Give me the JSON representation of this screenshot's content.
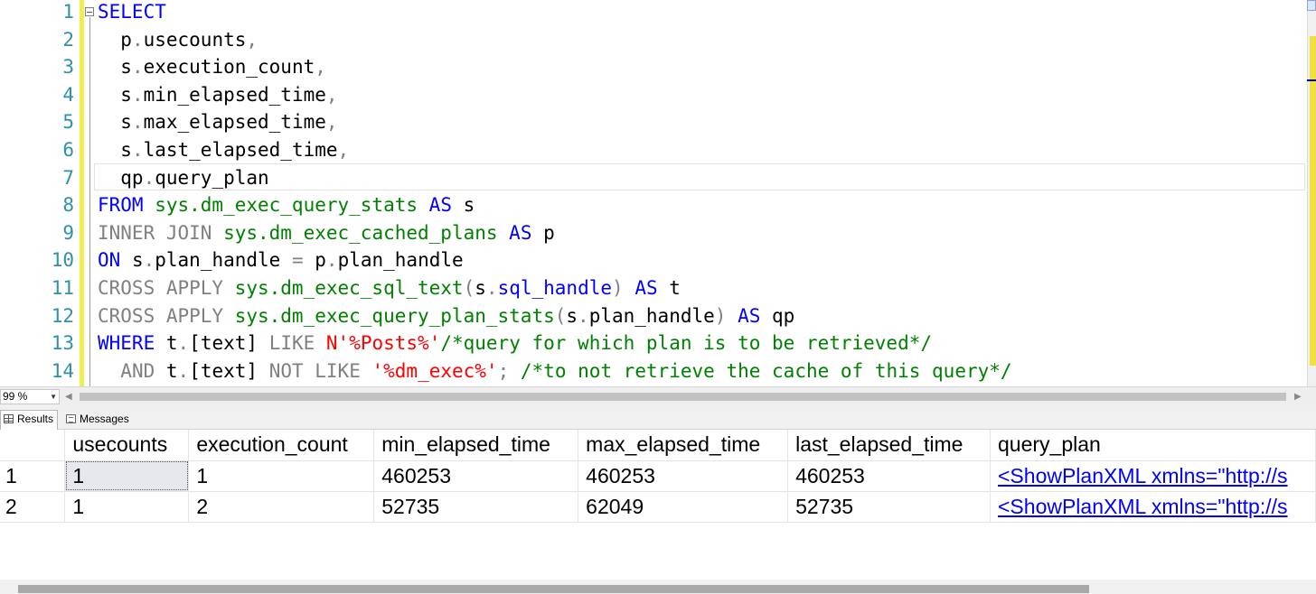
{
  "editor": {
    "line_numbers": [
      "1",
      "2",
      "3",
      "4",
      "5",
      "6",
      "7",
      "8",
      "9",
      "10",
      "11",
      "12",
      "13",
      "14"
    ],
    "lines": [
      [
        {
          "c": "kw",
          "t": "SELECT"
        }
      ],
      [
        {
          "c": "tx",
          "t": "  p"
        },
        {
          "c": "pu",
          "t": "."
        },
        {
          "c": "tx",
          "t": "usecounts"
        },
        {
          "c": "pu",
          "t": ","
        }
      ],
      [
        {
          "c": "tx",
          "t": "  s"
        },
        {
          "c": "pu",
          "t": "."
        },
        {
          "c": "tx",
          "t": "execution_count"
        },
        {
          "c": "pu",
          "t": ","
        }
      ],
      [
        {
          "c": "tx",
          "t": "  s"
        },
        {
          "c": "pu",
          "t": "."
        },
        {
          "c": "tx",
          "t": "min_elapsed_time"
        },
        {
          "c": "pu",
          "t": ","
        }
      ],
      [
        {
          "c": "tx",
          "t": "  s"
        },
        {
          "c": "pu",
          "t": "."
        },
        {
          "c": "tx",
          "t": "max_elapsed_time"
        },
        {
          "c": "pu",
          "t": ","
        }
      ],
      [
        {
          "c": "tx",
          "t": "  s"
        },
        {
          "c": "pu",
          "t": "."
        },
        {
          "c": "tx",
          "t": "last_elapsed_time"
        },
        {
          "c": "pu",
          "t": ","
        }
      ],
      [
        {
          "c": "tx",
          "t": "  qp"
        },
        {
          "c": "pu",
          "t": "."
        },
        {
          "c": "tx",
          "t": "query_plan"
        }
      ],
      [
        {
          "c": "kw",
          "t": "FROM "
        },
        {
          "c": "fn",
          "t": "sys.dm_exec_query_stats"
        },
        {
          "c": "tx",
          "t": " "
        },
        {
          "c": "kw",
          "t": "AS"
        },
        {
          "c": "tx",
          "t": " s"
        }
      ],
      [
        {
          "c": "gk",
          "t": "INNER JOIN "
        },
        {
          "c": "fn",
          "t": "sys.dm_exec_cached_plans"
        },
        {
          "c": "tx",
          "t": " "
        },
        {
          "c": "kw",
          "t": "AS"
        },
        {
          "c": "tx",
          "t": " p"
        }
      ],
      [
        {
          "c": "kw",
          "t": "ON"
        },
        {
          "c": "tx",
          "t": " s"
        },
        {
          "c": "pu",
          "t": "."
        },
        {
          "c": "tx",
          "t": "plan_handle "
        },
        {
          "c": "pu",
          "t": "="
        },
        {
          "c": "tx",
          "t": " p"
        },
        {
          "c": "pu",
          "t": "."
        },
        {
          "c": "tx",
          "t": "plan_handle"
        }
      ],
      [
        {
          "c": "gk",
          "t": "CROSS APPLY "
        },
        {
          "c": "fn",
          "t": "sys.dm_exec_sql_text"
        },
        {
          "c": "pu",
          "t": "("
        },
        {
          "c": "tx",
          "t": "s"
        },
        {
          "c": "pu",
          "t": "."
        },
        {
          "c": "kw",
          "t": "sql_handle"
        },
        {
          "c": "pu",
          "t": ")"
        },
        {
          "c": "tx",
          "t": " "
        },
        {
          "c": "kw",
          "t": "AS"
        },
        {
          "c": "tx",
          "t": " t"
        }
      ],
      [
        {
          "c": "gk",
          "t": "CROSS APPLY "
        },
        {
          "c": "fn",
          "t": "sys.dm_exec_query_plan_stats"
        },
        {
          "c": "pu",
          "t": "("
        },
        {
          "c": "tx",
          "t": "s"
        },
        {
          "c": "pu",
          "t": "."
        },
        {
          "c": "tx",
          "t": "plan_handle"
        },
        {
          "c": "pu",
          "t": ")"
        },
        {
          "c": "tx",
          "t": " "
        },
        {
          "c": "kw",
          "t": "AS"
        },
        {
          "c": "tx",
          "t": " qp"
        }
      ],
      [
        {
          "c": "kw",
          "t": "WHERE"
        },
        {
          "c": "tx",
          "t": " t"
        },
        {
          "c": "pu",
          "t": "."
        },
        {
          "c": "tx",
          "t": "[text] "
        },
        {
          "c": "gk",
          "t": "LIKE "
        },
        {
          "c": "st",
          "t": "N'%Posts%'"
        },
        {
          "c": "cm",
          "t": "/*query for which plan is to be retrieved*/"
        }
      ],
      [
        {
          "c": "tx",
          "t": "  "
        },
        {
          "c": "gk",
          "t": "AND"
        },
        {
          "c": "tx",
          "t": " t"
        },
        {
          "c": "pu",
          "t": "."
        },
        {
          "c": "tx",
          "t": "[text] "
        },
        {
          "c": "gk",
          "t": "NOT LIKE "
        },
        {
          "c": "st",
          "t": "'%dm_exec%'"
        },
        {
          "c": "pu",
          "t": ";"
        },
        {
          "c": "tx",
          "t": " "
        },
        {
          "c": "cm",
          "t": "/*to not retrieve the cache of this query*/"
        }
      ]
    ]
  },
  "zoom": {
    "value": "99 %"
  },
  "tabs": {
    "results": "Results",
    "messages": "Messages"
  },
  "grid": {
    "columns": [
      "usecounts",
      "execution_count",
      "min_elapsed_time",
      "max_elapsed_time",
      "last_elapsed_time",
      "query_plan"
    ],
    "rows": [
      {
        "num": "1",
        "usecounts": "1",
        "execution_count": "1",
        "min_elapsed_time": "460253",
        "max_elapsed_time": "460253",
        "last_elapsed_time": "460253",
        "query_plan": "<ShowPlanXML xmlns=\"http://s"
      },
      {
        "num": "2",
        "usecounts": "1",
        "execution_count": "2",
        "min_elapsed_time": "52735",
        "max_elapsed_time": "62049",
        "last_elapsed_time": "52735",
        "query_plan": "<ShowPlanXML xmlns=\"http://s"
      }
    ]
  },
  "colors": {
    "keyword": "#0000ff",
    "gray_keyword": "#808080",
    "system_object": "#008000",
    "string": "#ff0000",
    "comment": "#008000",
    "line_number": "#2b91af",
    "link": "#0000ff"
  }
}
